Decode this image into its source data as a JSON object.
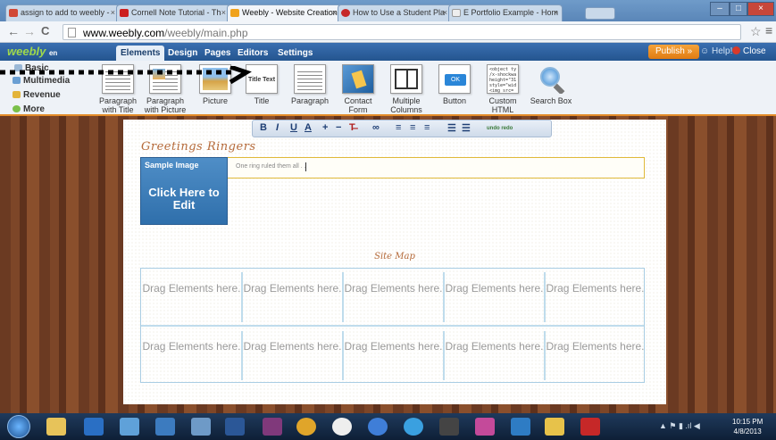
{
  "browser": {
    "tabs": [
      {
        "label": "assign to add to weebly - ",
        "icon_color": "#d14836",
        "active": false
      },
      {
        "label": "Cornell Note Tutorial - Th",
        "icon_color": "#cc1f1f",
        "active": false
      },
      {
        "label": "Weebly - Website Creation",
        "icon_color": "#f0a21c",
        "active": true
      },
      {
        "label": "How to Use a Student Pla",
        "icon_color": "#c62828",
        "active": false
      },
      {
        "label": "E Portfolio Example - Hom",
        "icon_color": "#cccccc",
        "active": false
      }
    ],
    "tab_close": "×",
    "url_host": "www.weebly.com",
    "url_path": "/weebly/main.php",
    "back": "←",
    "forward": "→",
    "reload": "C",
    "star": "☆",
    "menu": "≡"
  },
  "weebly": {
    "logo": "weebly",
    "logo_badge": "en",
    "tabs": [
      "Elements",
      "Design",
      "Pages",
      "Editors",
      "Settings"
    ],
    "publish": "Publish »",
    "help": "Help!",
    "close": "Close"
  },
  "palette": {
    "categories": [
      "Basic",
      "Multimedia",
      "Revenue",
      "More"
    ],
    "items": [
      {
        "label": "Paragraph with Title"
      },
      {
        "label": "Paragraph with Picture"
      },
      {
        "label": "Picture"
      },
      {
        "label": "Title",
        "thumb_text": "Title Text"
      },
      {
        "label": "Paragraph"
      },
      {
        "label": "Contact Form"
      },
      {
        "label": "Multiple Columns"
      },
      {
        "label": "Button",
        "thumb_text": "OK"
      },
      {
        "label": "Custom HTML",
        "thumb_text": "<object ty\n/x-shockwa\nheight=\"31\nstyle=\"wid\n<img src=\ntarget=\"_b"
      },
      {
        "label": "Search Box"
      }
    ]
  },
  "edit_toolbar": {
    "buttons": [
      "B",
      "I",
      "U",
      "A",
      "+",
      "−",
      "T̶",
      "∞",
      "≡",
      "≡",
      "≡",
      "☰",
      "☰",
      "undo redo"
    ]
  },
  "page": {
    "title": "Greetings Ringers",
    "image_label": "Sample Image",
    "image_cta": "Click Here to Edit",
    "text_placeholder": "One ring ruled them all . .",
    "sitemap": "Site Map",
    "drop_label": "Drag Elements here."
  },
  "taskbar": {
    "time": "10:15 PM",
    "date": "4/8/2013",
    "tray": "▲ ⚑ ▮ .ıl ◀"
  },
  "colors": {
    "accent_orange": "#e38c2a",
    "weebly_blue": "#24558f",
    "title_color": "#b56a3a"
  }
}
